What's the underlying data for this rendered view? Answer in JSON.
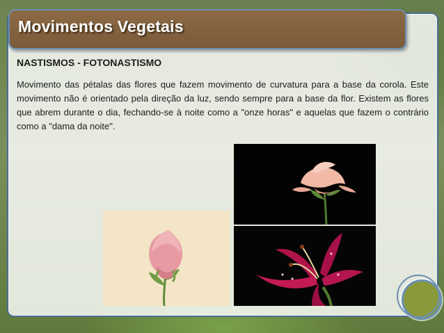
{
  "slide": {
    "title": "Movimentos Vegetais",
    "section_heading": "NASTISMOS - FOTONASTISMO",
    "body": "Movimento das pétalas das flores que fazem movimento de curvatura para a base da corola. Este movimento não é orientado pela direção da luz, sendo sempre para a base da flor. Existem as flores que abrem durante o dia, fechando-se à noite como a \"onze horas\" e aquelas que fazem o contrário como a \"dama da noite\"."
  },
  "colors": {
    "title_bar": "#8d6a45",
    "border_accent": "#6b8fb3",
    "title_text": "#ffffff",
    "body_text": "#1c1c1c"
  }
}
